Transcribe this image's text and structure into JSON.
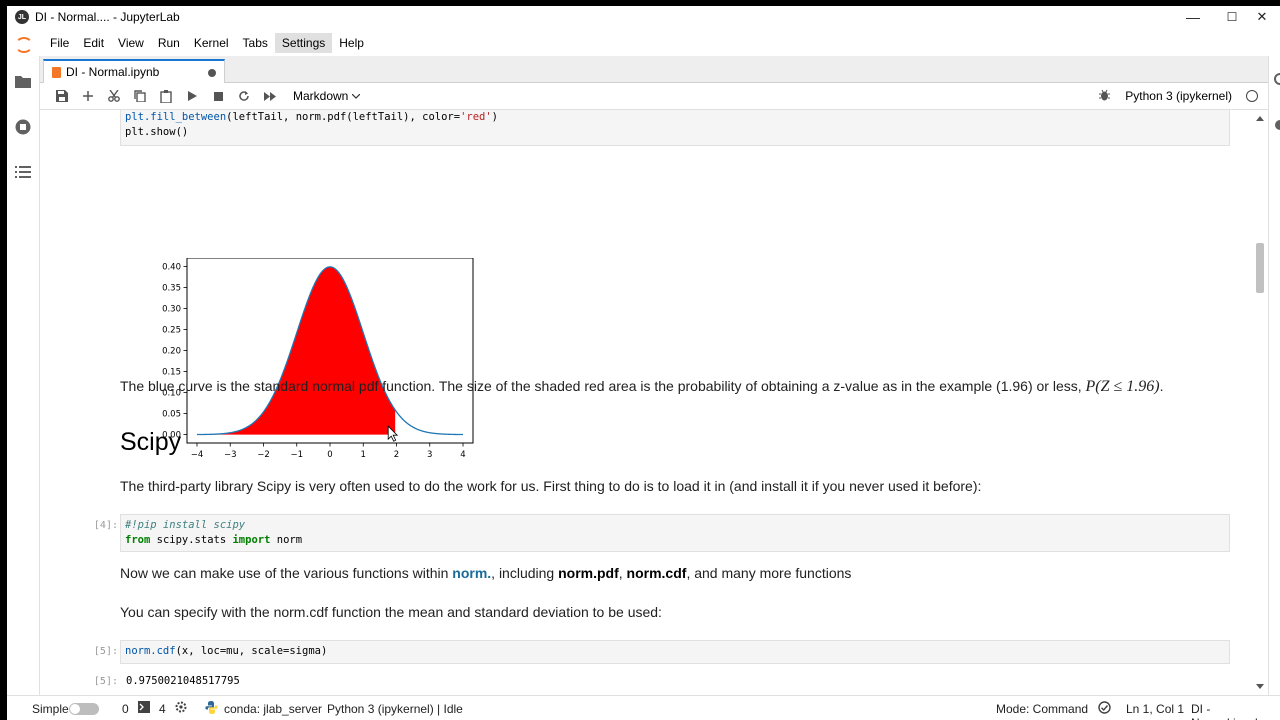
{
  "window": {
    "title": "DI - Normal.... - JupyterLab",
    "minimize": "—",
    "maximize": "☐",
    "close": "✕"
  },
  "menu": [
    "File",
    "Edit",
    "View",
    "Run",
    "Kernel",
    "Tabs",
    "Settings",
    "Help"
  ],
  "tab": {
    "label": "DI - Normal.ipynb"
  },
  "toolbar": {
    "cell_type": "Markdown",
    "kernel": "Python 3 (ipykernel)"
  },
  "cells": {
    "code_top": {
      "line1_fn": "plt.fill_between",
      "line1_rest": "(leftTail, norm.pdf(leftTail), color=",
      "line1_str": "'red'",
      "line1_end": ")",
      "line2": "plt.show()"
    },
    "para1_text": "The blue curve is the standard normal pdf function. The size of the shaded red area is the probability of obtaining a z-value as in the example (1.96) or less, ",
    "para1_math": "P(Z ≤ 1.96)",
    "para1_end": ".",
    "heading": "Scipy",
    "para2": "The third-party library Scipy is very often used to do the work for us. First thing to do is to load it in (and install it if you never used it before):",
    "cell4": {
      "prompt": "[4]:",
      "line1": "#!pip install scipy",
      "line2_kw1": "from",
      "line2_mod": " scipy.stats ",
      "line2_kw2": "import",
      "line2_name": " norm"
    },
    "para3": {
      "a": "Now we can make use of the various functions within ",
      "link": "norm.",
      "b": ", including ",
      "c": "norm.pdf",
      "d": ", ",
      "e": "norm.cdf",
      "f": ", and many more functions"
    },
    "para4": "You can specify with the norm.cdf function the mean and standard deviation to be used:",
    "cell5": {
      "prompt": "[5]:",
      "code_fn": "norm.cdf",
      "code_rest": "(x, loc=mu, scale=sigma)",
      "out_prompt": "[5]:",
      "output": "0.9750021048517795"
    }
  },
  "chart_data": {
    "type": "area",
    "title": "",
    "xlabel": "",
    "ylabel": "",
    "xlim": [
      -4.3,
      4.3
    ],
    "ylim": [
      -0.02,
      0.42
    ],
    "xticks": [
      "−4",
      "−3",
      "−2",
      "−1",
      "0",
      "1",
      "2",
      "3",
      "4"
    ],
    "yticks": [
      "0.00",
      "0.05",
      "0.10",
      "0.15",
      "0.20",
      "0.25",
      "0.30",
      "0.35",
      "0.40"
    ],
    "series": [
      {
        "kind": "line",
        "function": "standard normal pdf",
        "x_range": [
          -4,
          4
        ],
        "color": "#1f77b4"
      },
      {
        "kind": "fill",
        "function": "standard normal pdf",
        "x_range": [
          -4,
          1.96
        ],
        "color": "#ff0000"
      }
    ]
  },
  "statusbar": {
    "mode_label": "Simple",
    "count0": "0",
    "count4": "4",
    "conda": "conda: jlab_server",
    "kernel_status": "Python 3 (ipykernel) | Idle",
    "mode": "Mode: Command",
    "position": "Ln 1, Col 1",
    "file": "DI - Normal.ipynb"
  }
}
